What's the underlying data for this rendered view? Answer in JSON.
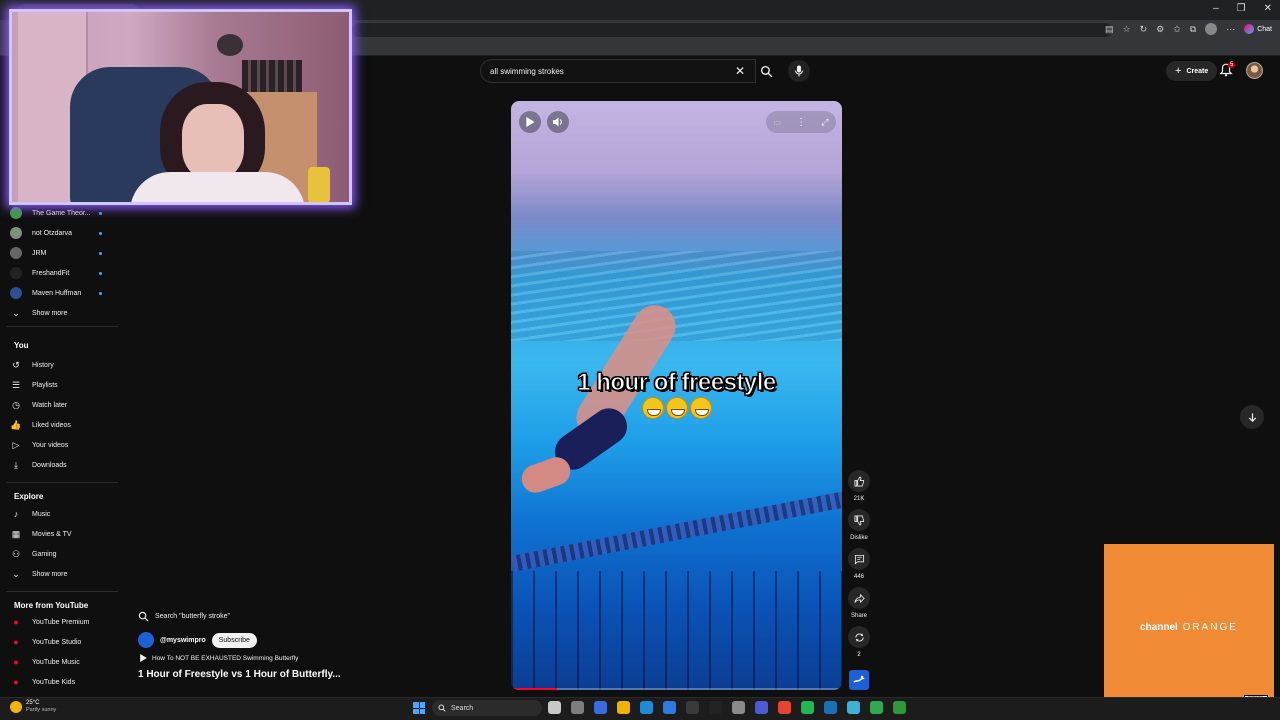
{
  "search": {
    "query": "all swimming strokes"
  },
  "header": {
    "create_label": "Create",
    "notification_count": "5",
    "chat_label": "Chat"
  },
  "sidebar": {
    "subscriptions": [
      {
        "label": "The Game Theor...",
        "color": "#3c9d3c"
      },
      {
        "label": "not Otzdarva",
        "color": "#7e8f7a"
      },
      {
        "label": "JRM",
        "color": "#666666"
      },
      {
        "label": "FreshandFit",
        "color": "#222222"
      },
      {
        "label": "Maven Huffman",
        "color": "#2c4f8f"
      }
    ],
    "subs_show_more": "Show more",
    "you_heading": "You",
    "you_items": [
      {
        "label": "History",
        "icon": "history-icon"
      },
      {
        "label": "Playlists",
        "icon": "playlists-icon"
      },
      {
        "label": "Watch later",
        "icon": "watch-later-icon"
      },
      {
        "label": "Liked videos",
        "icon": "liked-icon"
      },
      {
        "label": "Your videos",
        "icon": "your-videos-icon"
      },
      {
        "label": "Downloads",
        "icon": "downloads-icon"
      }
    ],
    "explore_heading": "Explore",
    "explore_items": [
      {
        "label": "Music",
        "icon": "music-icon"
      },
      {
        "label": "Movies & TV",
        "icon": "movies-icon"
      },
      {
        "label": "Gaming",
        "icon": "gaming-icon"
      }
    ],
    "explore_show_more": "Show more",
    "more_heading": "More from YouTube",
    "more_items": [
      {
        "label": "YouTube Premium"
      },
      {
        "label": "YouTube Studio"
      },
      {
        "label": "YouTube Music"
      },
      {
        "label": "YouTube Kids"
      }
    ]
  },
  "short": {
    "caption": "1 hour of freestyle",
    "progress": 0.14,
    "likes": "21K",
    "dislike_label": "Dislike",
    "comments": "446",
    "share_label": "Share",
    "remix_count": "2"
  },
  "info": {
    "related_search": "Search \"butterfly stroke\"",
    "channel_handle": "@myswimpro",
    "subscribe_label": "Subscribe",
    "related_video": "How To NOT BE EXHAUSTED Swimming Butterfly",
    "title": "1 Hour of Freestyle vs 1 Hour of Butterfly..."
  },
  "album": {
    "text_bold": "channel",
    "text_rest": "ORANGE",
    "advisory": "PARENTAL ADVISORY EXPLICIT CONTENT"
  },
  "taskbar": {
    "temp": "25°C",
    "weather": "Partly sunny",
    "search_label": "Search"
  },
  "colors": {
    "accent_red": "#ff0033",
    "live_dot": "#3ea6ff",
    "album_orange": "#f08a35"
  }
}
